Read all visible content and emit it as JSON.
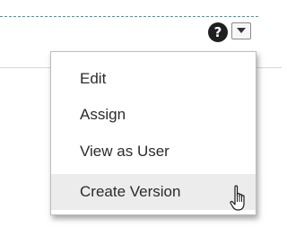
{
  "toolbar": {
    "help_icon": "?",
    "help_icon_name": "help-icon",
    "dropdown_icon_name": "chevron-down-icon"
  },
  "menu": {
    "items": [
      {
        "label": "Edit"
      },
      {
        "label": "Assign"
      },
      {
        "label": "View as User"
      },
      {
        "label": "Create Version",
        "hovered": true
      }
    ]
  },
  "colors": {
    "dashed_line": "#3d9aa0",
    "hover_bg": "#ececec",
    "help_bg": "#1f1f1f"
  },
  "cursor": {
    "type": "hand-pointer-icon"
  }
}
